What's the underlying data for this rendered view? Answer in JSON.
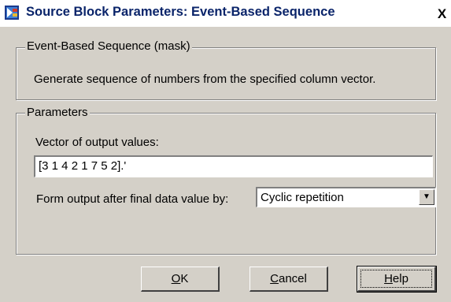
{
  "window": {
    "title": "Source Block Parameters: Event-Based Sequence",
    "close_label": "X"
  },
  "mask_group": {
    "legend": "Event-Based Sequence (mask)",
    "description": "Generate sequence of numbers from the specified column vector."
  },
  "params_group": {
    "legend": "Parameters",
    "vector_label": "Vector of output values:",
    "vector_value": "[3 1 4 2 1 7 5 2].'",
    "form_label": "Form output after final data value by:",
    "form_value": "Cyclic repetition"
  },
  "buttons": {
    "ok_mnemonic": "O",
    "ok_rest": "K",
    "cancel_mnemonic": "C",
    "cancel_rest": "ancel",
    "help_mnemonic": "H",
    "help_rest": "elp"
  },
  "colors": {
    "title_text": "#0a246a",
    "dialog_bg": "#d4d0c8"
  },
  "icons": {
    "window_icon": "simulink-block-icon",
    "dropdown_icon": "chevron-down-icon"
  }
}
